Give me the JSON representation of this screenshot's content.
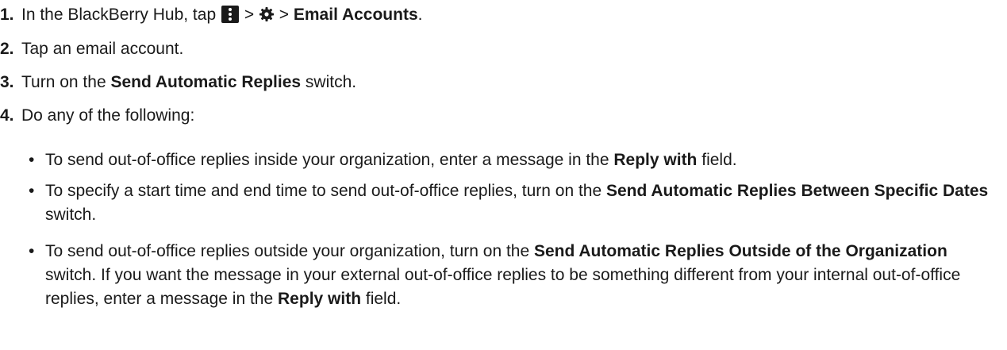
{
  "steps": [
    {
      "number": "1.",
      "pre": "In the BlackBerry Hub, tap",
      "sep1": ">",
      "sep2": ">",
      "bold": "Email Accounts",
      "post": ".",
      "icons": [
        "more-menu-icon",
        "gear-icon"
      ]
    },
    {
      "number": "2.",
      "text": "Tap an email account."
    },
    {
      "number": "3.",
      "pre": "Turn on the",
      "bold": "Send Automatic Replies",
      "post": "switch."
    },
    {
      "number": "4.",
      "text": "Do any of the following:"
    }
  ],
  "bullets": [
    {
      "symbol": "•",
      "pre": "To send out-of-office replies inside your organization, enter a message in the",
      "bold": "Reply with",
      "post": "field."
    },
    {
      "symbol": "•",
      "pre": "To specify a start time and end time to send out-of-office replies, turn on the",
      "bold": "Send Automatic Replies Between Specific Dates",
      "post": "switch."
    },
    {
      "symbol": "•",
      "pre": "To send out-of-office replies outside your organization, turn on the",
      "bold": "Send Automatic Replies Outside of the Organization",
      "mid": "switch. If you want the message in your external out-of-office replies to be something different from your internal out-of-office replies, enter a message in the",
      "bold2": "Reply with",
      "post": "field."
    }
  ]
}
